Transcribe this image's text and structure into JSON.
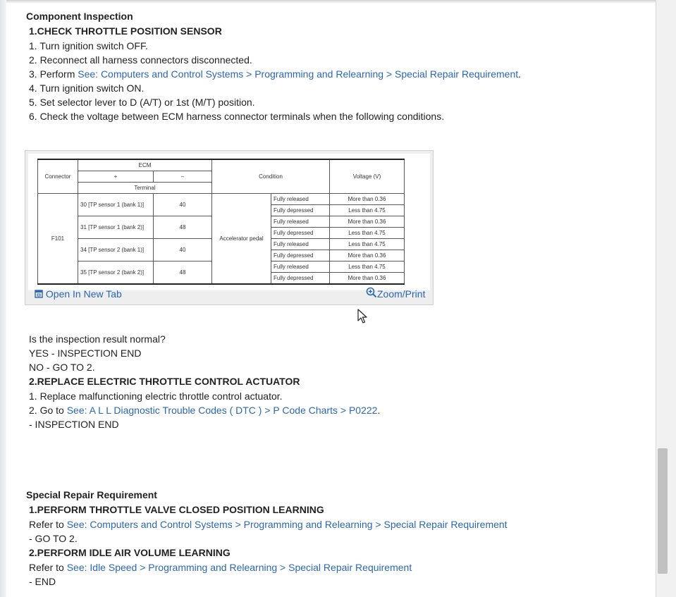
{
  "section1": {
    "title": "Component Inspection",
    "step1_heading": "1.CHECK THROTTLE POSITION SENSOR",
    "steps": [
      {
        "text": "1. Turn ignition switch OFF."
      },
      {
        "text": "2. Reconnect all harness connectors disconnected."
      },
      {
        "prefix": "3. Perform ",
        "link": "See: Computers and Control Systems > Programming and Relearning > Special Repair Requirement",
        "suffix": "."
      },
      {
        "text": "4. Turn ignition switch ON."
      },
      {
        "text": "5. Set selector lever to D (A/T) or 1st (M/T) position."
      },
      {
        "text": "6. Check the voltage between ECM harness connector terminals when the following conditions."
      }
    ]
  },
  "figure": {
    "headers": {
      "ecm": "ECM",
      "connector": "Connector",
      "plus": "+",
      "minus": "–",
      "terminal": "Terminal",
      "condition": "Condition",
      "voltage": "Voltage (V)"
    },
    "connector": "F101",
    "condition_main": "Accelerator pedal",
    "rows": [
      {
        "plus": "30 [TP sensor 1 (bank 1)]",
        "minus": "40",
        "c1": "Fully released",
        "v1": "More than 0.36",
        "c2": "Fully depressed",
        "v2": "Less than 4.75"
      },
      {
        "plus": "31 [TP sensor 1 (bank 2)]",
        "minus": "48",
        "c1": "Fully released",
        "v1": "More than 0.36",
        "c2": "Fully depressed",
        "v2": "Less than 4.75"
      },
      {
        "plus": "34 [TP sensor 2 (bank 1)]",
        "minus": "40",
        "c1": "Fully released",
        "v1": "Less than 4.75",
        "c2": "Fully depressed",
        "v2": "More than 0.36"
      },
      {
        "plus": "35 [TP sensor 2 (bank 2)]",
        "minus": "48",
        "c1": "Fully released",
        "v1": "Less than 4.75",
        "c2": "Fully depressed",
        "v2": "More than 0.36"
      }
    ],
    "open_tab": "Open In New Tab",
    "zoom_print": "Zoom/Print"
  },
  "result": {
    "question": "Is the inspection result normal?",
    "yes": "YES - INSPECTION END",
    "no": "NO - GO TO 2."
  },
  "step2": {
    "heading": "2.REPLACE ELECTRIC THROTTLE CONTROL ACTUATOR",
    "line1": "1. Replace malfunctioning electric throttle control actuator.",
    "line2_prefix": "2. Go to ",
    "line2_link": "See: A L L Diagnostic Trouble Codes ( DTC ) > P Code Charts > P0222",
    "line2_suffix": ".",
    "line3": "- INSPECTION END"
  },
  "section2": {
    "title": "Special Repair Requirement",
    "h1": "1.PERFORM THROTTLE VALVE CLOSED POSITION LEARNING",
    "r1_prefix": "Refer to ",
    "r1_link": "See: Computers and Control Systems > Programming and Relearning > Special Repair Requirement",
    "r1_next": "- GO TO 2.",
    "h2": "2.PERFORM IDLE AIR VOLUME LEARNING",
    "r2_prefix": "Refer to ",
    "r2_link": "See: Idle Speed > Programming and Relearning > Special Repair Requirement",
    "r2_next": "- END"
  },
  "colors": {
    "link": "#2a67b5",
    "text": "#222222"
  },
  "icons": [
    "open-in-new-tab-icon",
    "zoom-icon",
    "mouse-cursor-icon"
  ]
}
